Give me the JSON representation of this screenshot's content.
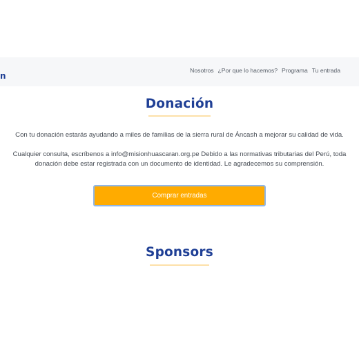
{
  "navbar": {
    "brand_fragment": "n",
    "links": [
      "Nosotros",
      "¿Por que lo hacemos?",
      "Programa",
      "Tu entrada"
    ]
  },
  "donation": {
    "title": "Donación",
    "paragraph_1": "Con tu donación estarás ayudando a miles de familias de la sierra rural de Áncash a mejorar su calidad de vida.",
    "paragraph_2_line_1": "Cualquier consulta, escríbenos a info@misionhuascaran.org.pe Debido a las normativas tributarias del Perú, toda",
    "paragraph_2_line_2": "donación debe estar registrada con un documento de identidad. Le agradecemos su comprensión.",
    "button_label": "Comprar entradas"
  },
  "sponsors": {
    "title": "Sponsors"
  },
  "colors": {
    "brand_blue": "#1f3f95",
    "accent_orange": "#ffab00",
    "underline": "#fde0a8",
    "navbar_bg": "#f6f7f9"
  }
}
